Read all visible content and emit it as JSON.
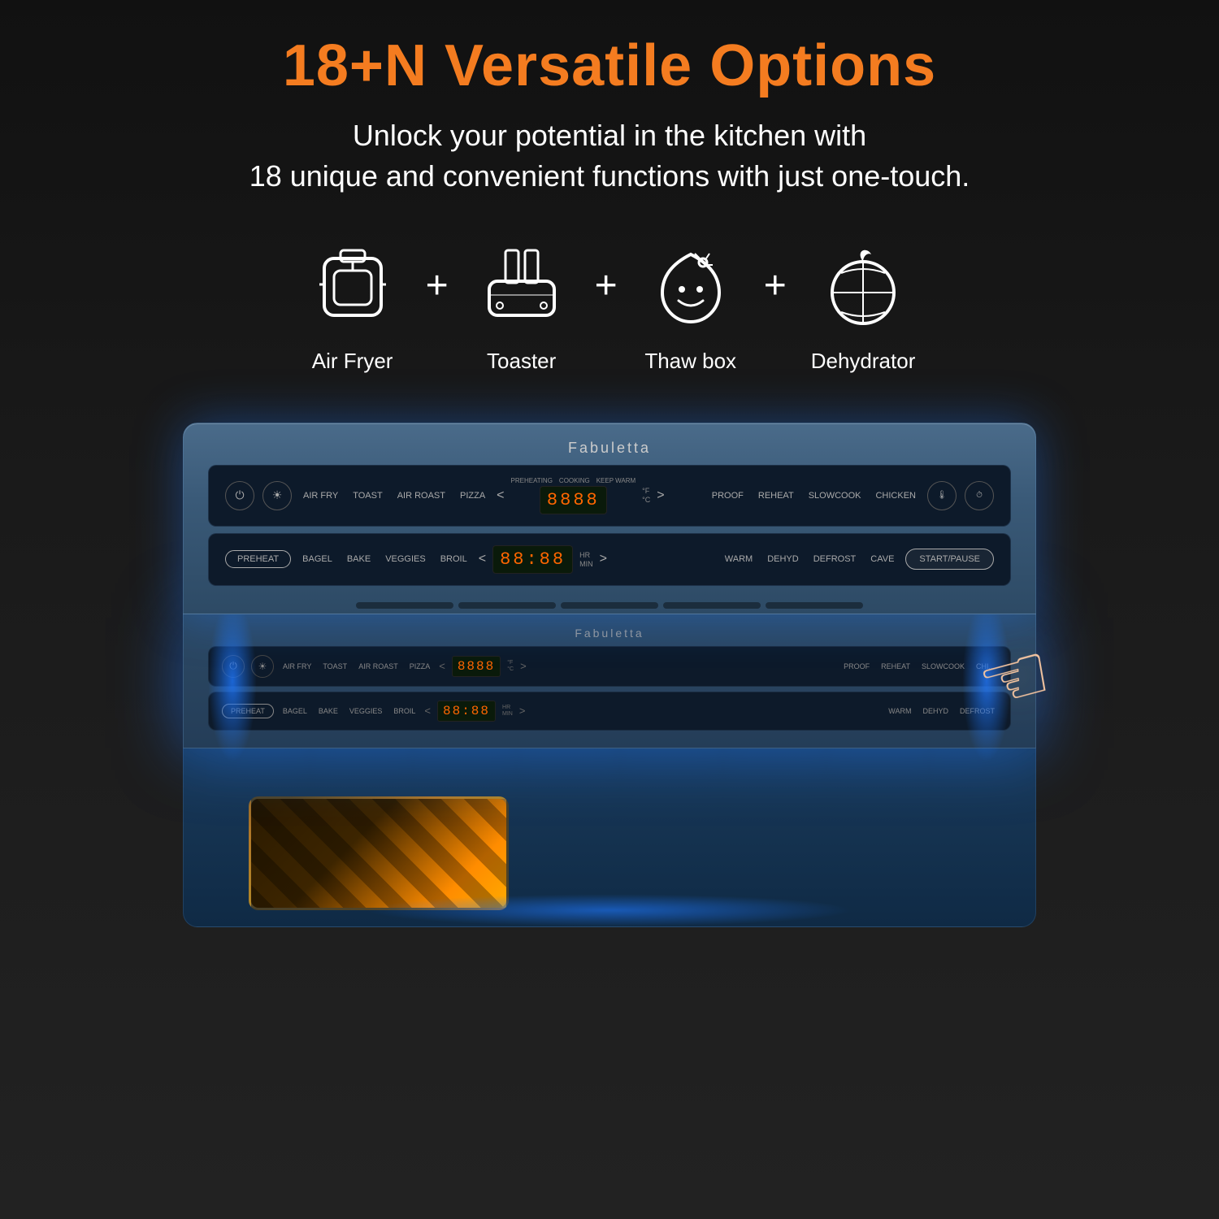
{
  "header": {
    "title": "18+N Versatile Options",
    "subtitle_line1": "Unlock your potential in the kitchen with",
    "subtitle_line2": "18 unique and convenient functions with just one-touch."
  },
  "features": [
    {
      "id": "air-fryer",
      "label": "Air Fryer",
      "icon": "air-fryer-icon"
    },
    {
      "id": "toaster",
      "label": "Toaster",
      "icon": "toaster-icon"
    },
    {
      "id": "thaw-box",
      "label": "Thaw box",
      "icon": "thaw-box-icon"
    },
    {
      "id": "dehydrator",
      "label": "Dehydrator",
      "icon": "dehydrator-icon"
    }
  ],
  "brand": "Fabuletta",
  "panel": {
    "row1_buttons": [
      "AIR FRY",
      "TOAST",
      "AIR ROAST",
      "PIZZA"
    ],
    "row2_buttons": [
      "BAGEL",
      "BAKE",
      "VEGGIES",
      "BROIL"
    ],
    "row1_right": [
      "PROOF",
      "REHEAT",
      "SLOWCOOK",
      "CHICKEN"
    ],
    "row2_right": [
      "WARM",
      "DEHYD",
      "DEFROST",
      "CAVE"
    ],
    "display1": "8888",
    "display2": "88:88",
    "unit1": [
      "°F",
      "°C"
    ],
    "unit2": [
      "HR",
      "MIN"
    ],
    "preheat": "PREHEAT",
    "start_pause": "START/PAUSE",
    "indicators": [
      "PREHEATING",
      "COOKING",
      "KEEP WARM"
    ]
  }
}
